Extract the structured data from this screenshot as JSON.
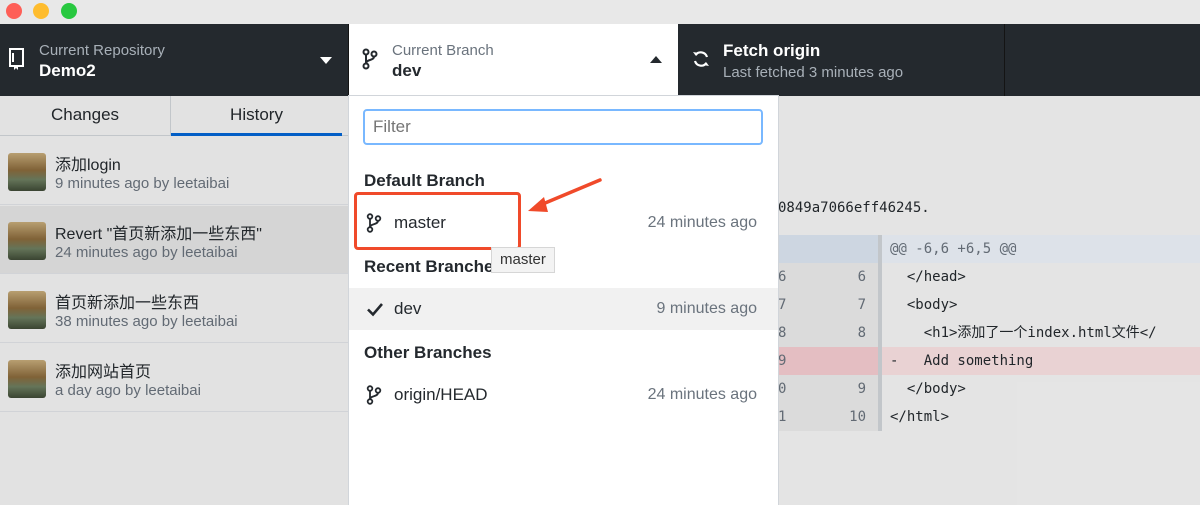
{
  "colors": {
    "accent": "#0366d6",
    "annotation": "#f04a2a",
    "toolbar_bg": "#24292e"
  },
  "toolbar": {
    "repo_label": "Current Repository",
    "repo_value": "Demo2",
    "branch_label": "Current Branch",
    "branch_value": "dev",
    "fetch_title": "Fetch origin",
    "fetch_subtitle": "Last fetched 3 minutes ago"
  },
  "tabs": {
    "changes": "Changes",
    "history": "History"
  },
  "commits": [
    {
      "title": "添加login",
      "meta": "9 minutes ago by leetaibai"
    },
    {
      "title": "Revert \"首页新添加一些东西\"",
      "meta": "24 minutes ago by leetaibai"
    },
    {
      "title": "首页新添加一些东西",
      "meta": "38 minutes ago by leetaibai"
    },
    {
      "title": "添加网站首页",
      "meta": "a day ago by leetaibai"
    }
  ],
  "dropdown": {
    "filter_placeholder": "Filter",
    "default_heading": "Default Branch",
    "recent_heading": "Recent Branches",
    "other_heading": "Other Branches",
    "default_branch": {
      "name": "master",
      "time": "24 minutes ago"
    },
    "recent_branch": {
      "name": "dev",
      "time": "9 minutes ago"
    },
    "other_branch": {
      "name": "origin/HEAD",
      "time": "24 minutes ago"
    },
    "tooltip": "master"
  },
  "diff": {
    "sha_fragment": "0849a7066eff46245.",
    "rows": [
      {
        "old": "",
        "new": "",
        "code": "@@ -6,6 +6,5 @@"
      },
      {
        "old": "6",
        "new": "6",
        "code": "  </head>"
      },
      {
        "old": "7",
        "new": "7",
        "code": "  <body>"
      },
      {
        "old": "8",
        "new": "8",
        "code": "    <h1>添加了一个index.html文件</"
      },
      {
        "old": "9",
        "new": "",
        "code": "-   Add something"
      },
      {
        "old": "0",
        "new": "9",
        "code": "  </body>"
      },
      {
        "old": "1",
        "new": "10",
        "code": "</html>"
      }
    ]
  }
}
